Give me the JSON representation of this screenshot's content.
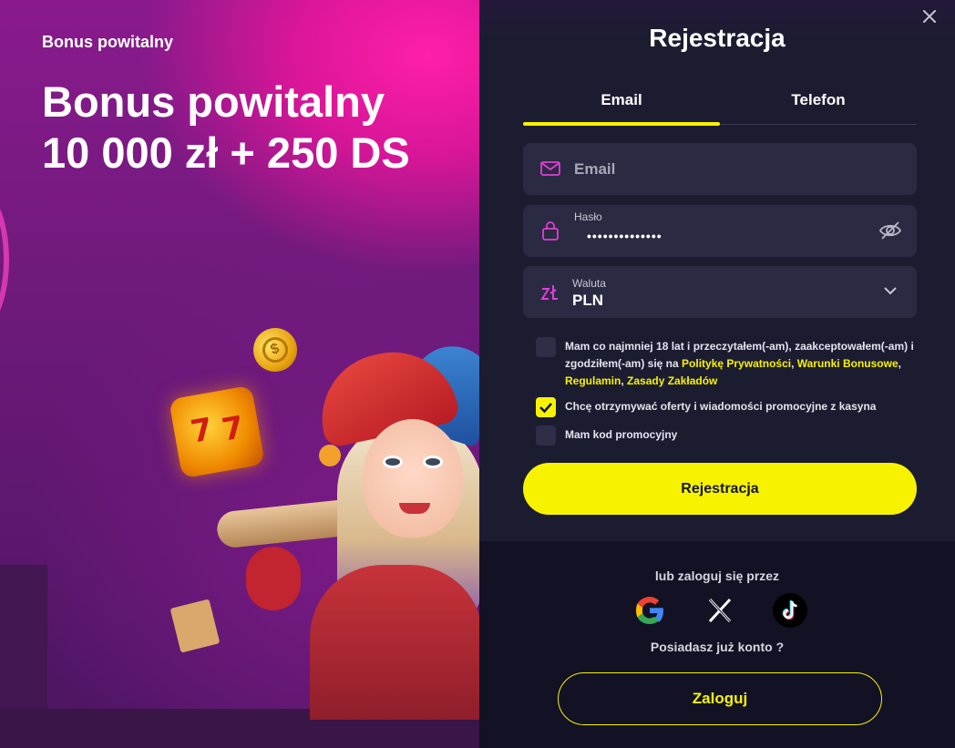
{
  "promo": {
    "eyebrow": "Bonus powitalny",
    "title_line1": "Bonus powitalny",
    "title_line2": "10 000 zł + 250 DS",
    "coin_symbol": "$",
    "dice_glyphs": [
      "7",
      "7"
    ]
  },
  "dialog": {
    "title": "Rejestracja",
    "close_icon": "close-icon"
  },
  "tabs": [
    {
      "label": "Email",
      "active": true
    },
    {
      "label": "Telefon",
      "active": false
    }
  ],
  "fields": {
    "email": {
      "placeholder": "Email",
      "value": "",
      "icon": "mail-icon"
    },
    "password": {
      "label": "Hasło",
      "value": "••••••••••••••",
      "icon": "lock-icon",
      "toggle_icon": "eye-off-icon"
    },
    "currency": {
      "label": "Waluta",
      "value": "PLN",
      "icon": "zloty-icon",
      "dropdown_icon": "chevron-down-icon"
    }
  },
  "checkboxes": {
    "terms": {
      "checked": false,
      "text_prefix": "Mam co najmniej 18 lat i przeczytałem(-am), zaakceptowałem(-am) i zgodziłem(-am) się na ",
      "link_privacy": "Politykę Prywatności",
      "sep1": ", ",
      "link_bonus": "Warunki Bonusowe",
      "sep2": ",",
      "link_rules": "Regulamin",
      "sep3": ", ",
      "link_bets": "Zasady Zakładów"
    },
    "marketing": {
      "checked": true,
      "text": "Chcę otrzymywać oferty i wiadomości promocyjne z kasyna"
    },
    "promo_code": {
      "checked": false,
      "text": "Mam kod promocyjny"
    }
  },
  "register_button": "Rejestracja",
  "social": {
    "or_text": "lub zaloguj się przez",
    "providers": [
      "google-icon",
      "x-icon",
      "tiktok-icon"
    ]
  },
  "login": {
    "question": "Posiadasz już konto ?",
    "button": "Zaloguj"
  },
  "colors": {
    "accent": "#f7f300",
    "panel": "#1c1c31",
    "field": "#2a2a42",
    "icon_magenta": "#e03fd8",
    "promo_pink": "#ff1fa8"
  }
}
